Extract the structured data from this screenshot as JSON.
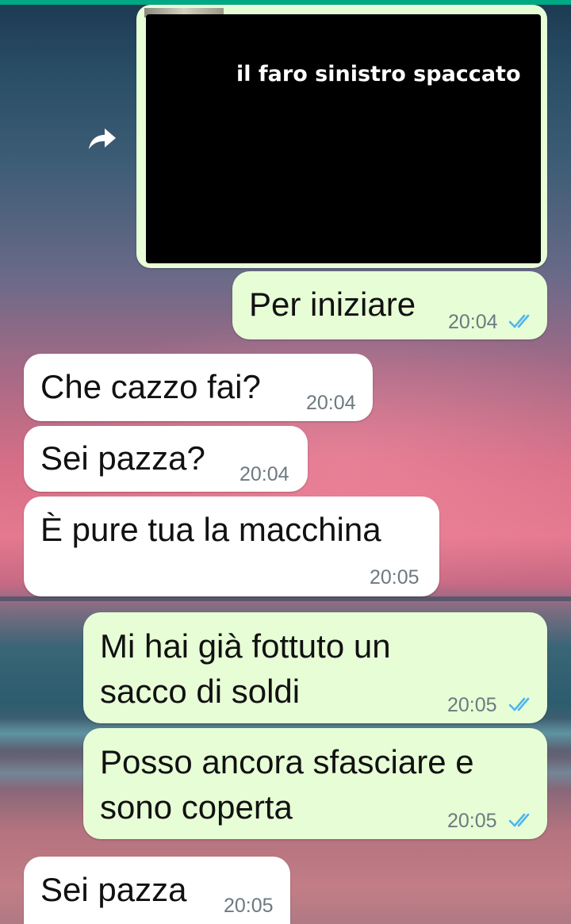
{
  "colors": {
    "accent_top": "#00a884",
    "outgoing_bubble": "#e7fdd6",
    "incoming_bubble": "#ffffff",
    "read_ticks": "#4fb6ec",
    "timestamp": "#6d7a80"
  },
  "media": {
    "caption": "il faro sinistro spaccato",
    "forward_icon": "forward-arrow-icon"
  },
  "messages": [
    {
      "direction": "outgoing",
      "lines": [
        "Per iniziare"
      ],
      "time": "20:04",
      "status": "read"
    },
    {
      "direction": "incoming",
      "lines": [
        "Che cazzo fai?"
      ],
      "time": "20:04"
    },
    {
      "direction": "incoming",
      "lines": [
        "Sei pazza?"
      ],
      "time": "20:04"
    },
    {
      "direction": "incoming",
      "lines": [
        "È pure tua la macchina"
      ],
      "time": "20:05"
    },
    {
      "direction": "outgoing",
      "lines": [
        "Mi hai già fottuto un",
        "sacco di soldi"
      ],
      "time": "20:05",
      "status": "read"
    },
    {
      "direction": "outgoing",
      "lines": [
        "Posso ancora sfasciare e",
        "sono coperta"
      ],
      "time": "20:05",
      "status": "read"
    },
    {
      "direction": "incoming",
      "lines": [
        "Sei pazza"
      ],
      "time": "20:05"
    }
  ]
}
